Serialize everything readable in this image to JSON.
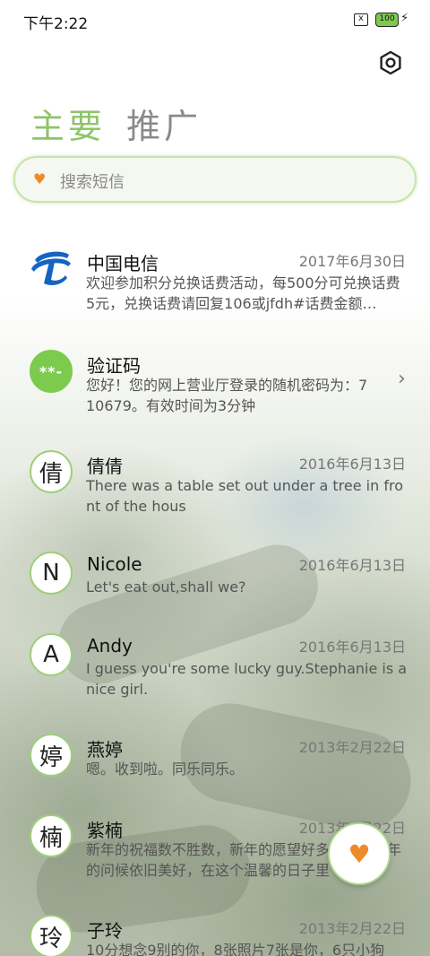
{
  "status_bar": {
    "time": "下午2:22",
    "sim_icon": "x",
    "battery": "100"
  },
  "tabs": [
    {
      "label": "主要",
      "active": true
    },
    {
      "label": "推广",
      "active": false
    }
  ],
  "search": {
    "placeholder": "搜索短信"
  },
  "messages": [
    {
      "avatar": "",
      "avatar_type": "telecom-logo",
      "name": "中国电信",
      "date": "2017年6月30日",
      "preview": "欢迎参加积分兑换话费活动，每500分可兑换话费5元，兑换话费请回复106或jfdh#话费金额…"
    },
    {
      "avatar": "**-",
      "avatar_type": "filled",
      "name": "验证码",
      "date": "",
      "preview": "您好！您的网上营业厅登录的随机密码为：710679。有效时间为3分钟",
      "chevron": "›"
    },
    {
      "avatar": "倩",
      "name": "倩倩",
      "date": "2016年6月13日",
      "preview": "There was a table set out under a tree in front of the hous"
    },
    {
      "avatar": "N",
      "name": "Nicole",
      "date": "2016年6月13日",
      "preview": "Let's eat out,shall we?"
    },
    {
      "avatar": "A",
      "name": "Andy",
      "date": "2016年6月13日",
      "preview": "I guess you're some lucky guy.Stephanie is a nice girl."
    },
    {
      "avatar": "婷",
      "name": "燕婷",
      "date": "2013年2月22日",
      "preview": "嗯。收到啦。同乐同乐。"
    },
    {
      "avatar": "楠",
      "name": "紫楠",
      "date": "2013年2月22日",
      "preview": "新年的祝福数不胜数，新年的愿望好多好多，新年的问候依旧美好，在这个温馨的日子里"
    },
    {
      "avatar": "玲",
      "name": "子玲",
      "date": "2013年2月22日",
      "preview": "10分想念9别的你，8张照片7张是你，6只小狗"
    }
  ],
  "colors": {
    "accent": "#8fc46a",
    "heart": "#ef8a2a",
    "avatar_ring": "#9fcf7b"
  },
  "icons": {
    "settings": "settings-icon",
    "heart": "heart-icon",
    "compose": "compose-fab"
  }
}
